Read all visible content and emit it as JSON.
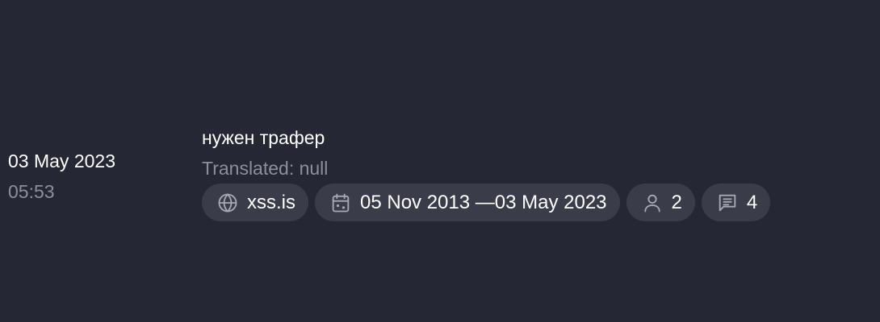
{
  "entry": {
    "date": "03 May 2023",
    "time": "05:53",
    "title": "нужен трафер",
    "translated": "Translated: null",
    "chips": {
      "source": {
        "label": "xss.is",
        "icon": "globe-icon"
      },
      "period": {
        "label": "05 Nov 2013 —03 May 2023",
        "icon": "calendar-icon"
      },
      "users": {
        "label": "2",
        "icon": "user-icon"
      },
      "messages": {
        "label": "4",
        "icon": "message-icon"
      }
    }
  },
  "colors": {
    "background": "#252834",
    "chip": "#3a3d49",
    "text": "#ffffff",
    "muted": "#8d909a",
    "icon": "#a6a9b3"
  }
}
